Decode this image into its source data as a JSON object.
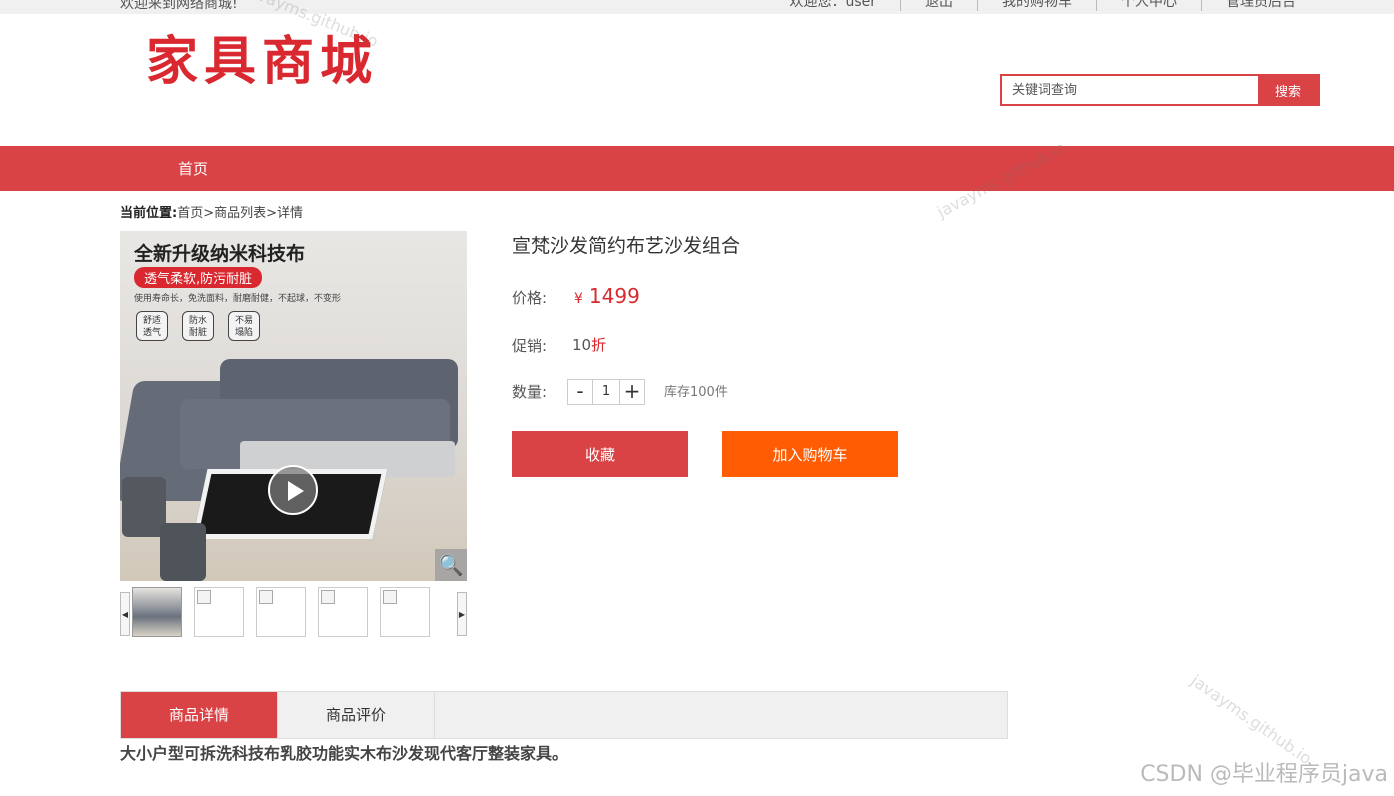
{
  "topbar": {
    "welcome": "欢迎来到网络商城!",
    "user_greeting": "欢迎您：user",
    "links": [
      "退出",
      "我的购物车",
      "个人中心",
      "管理员后台"
    ]
  },
  "header": {
    "logo_text": "家具商城",
    "search_placeholder": "关键词查询",
    "search_button": "搜索"
  },
  "nav": {
    "home": "首页"
  },
  "breadcrumb": {
    "label": "当前位置:",
    "path": "首页>商品列表>详情"
  },
  "gallery": {
    "banner_title": "全新升级纳米科技布",
    "banner_tag": "透气柔软,防污耐脏",
    "banner_sub": "使用寿命长，免洗面料，耐磨耐健，不起球，不变形",
    "badges": [
      "舒适\n透气",
      "防水\n耐脏",
      "不易\n塌陷"
    ],
    "zoom_icon": "magnifier-icon",
    "play_icon": "play-icon"
  },
  "product": {
    "title": "宣梵沙发简约布艺沙发组合",
    "price_label": "价格:",
    "currency": "¥",
    "price": "1499",
    "promo_label": "促销:",
    "promo_value": "10",
    "promo_unit": "折",
    "qty_label": "数量:",
    "qty_minus": "-",
    "qty_value": "1",
    "qty_plus": "+",
    "stock": "库存100件",
    "fav_button": "收藏",
    "cart_button": "加入购物车"
  },
  "tabs": [
    {
      "label": "商品详情"
    },
    {
      "label": "商品评价"
    }
  ],
  "description": "大小户型可拆洗科技布乳胶功能实木布沙发现代客厅整装家具。",
  "watermarks": {
    "site": "javayms.github.io",
    "csdn": "CSDN @毕业程序员java"
  },
  "colors": {
    "brand_red": "#d94346",
    "cart_orange": "#ff5c04",
    "price_red": "#d9282f"
  }
}
